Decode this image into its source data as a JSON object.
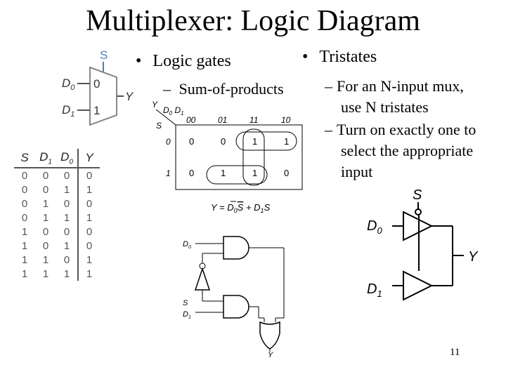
{
  "slide": {
    "title": "Multiplexer: Logic Diagram",
    "page_number": "11"
  },
  "bullets": {
    "logic_gates": "Logic gates",
    "sum_of_products": "Sum-of-products",
    "tristates": "Tristates",
    "tristate_sub1": "For an N-input mux, use N tristates",
    "tristate_sub1_line1": "For an N-input mux,",
    "tristate_sub1_line2": "use N tristates",
    "tristate_sub2_line1": "Turn on exactly one to",
    "tristate_sub2_line2": "select the appropriate",
    "tristate_sub2_line3": "input",
    "dash": "–",
    "dot": "•"
  },
  "mux_symbol": {
    "select": "S",
    "input0_label": "D0",
    "input1_label": "D1",
    "port0": "0",
    "port1": "1",
    "output": "Y",
    "accent_color": "#4a7ebb"
  },
  "truth_table": {
    "headers": [
      "S",
      "D1",
      "D0",
      "Y"
    ],
    "rows": [
      [
        "0",
        "0",
        "0",
        "0"
      ],
      [
        "0",
        "0",
        "1",
        "1"
      ],
      [
        "0",
        "1",
        "0",
        "0"
      ],
      [
        "0",
        "1",
        "1",
        "1"
      ],
      [
        "1",
        "0",
        "0",
        "0"
      ],
      [
        "1",
        "0",
        "1",
        "0"
      ],
      [
        "1",
        "1",
        "0",
        "1"
      ],
      [
        "1",
        "1",
        "1",
        "1"
      ]
    ]
  },
  "kmap": {
    "corner_output": "Y",
    "row_var": "S",
    "col_vars": "D0 D1",
    "col_headers": [
      "00",
      "01",
      "11",
      "10"
    ],
    "row_headers": [
      "0",
      "1"
    ],
    "cells": [
      [
        "0",
        "0",
        "1",
        "1"
      ],
      [
        "0",
        "1",
        "1",
        "0"
      ]
    ],
    "equation": "Y = D0S + D1S",
    "equation_parts": {
      "y": "Y = D",
      "sub0": "0",
      "s_bar": "S",
      "plus": " + D",
      "sub1": "1",
      "s": "S"
    }
  },
  "gate_diagram": {
    "input_d0": "D0",
    "input_s": "S",
    "input_d1": "D1",
    "output": "Y"
  },
  "tristate_diagram": {
    "select": "S",
    "input0": "D0",
    "input1": "D1",
    "output": "Y"
  }
}
